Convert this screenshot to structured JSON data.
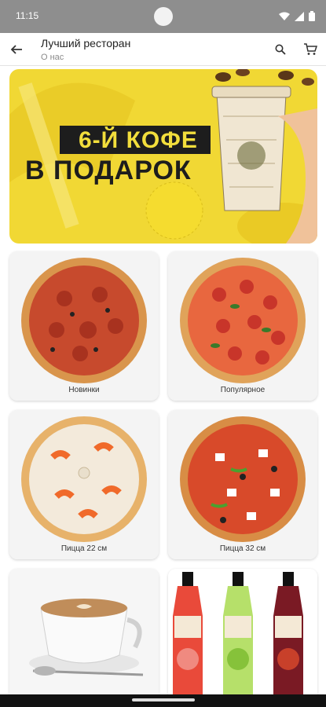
{
  "status_bar": {
    "time": "11:15"
  },
  "app_bar": {
    "title": "Лучший ресторан",
    "subtitle": "О нас"
  },
  "banner": {
    "line1": "6-Й КОФЕ",
    "line2": "В ПОДАРОК"
  },
  "categories": [
    {
      "label": "Новинки"
    },
    {
      "label": "Популярное"
    },
    {
      "label": "Пицца 22 см"
    },
    {
      "label": "Пицца 32 см"
    },
    {
      "label": ""
    },
    {
      "label": ""
    }
  ],
  "colors": {
    "banner_yellow": "#f1d834",
    "status_bar": "#8e8e8e"
  }
}
